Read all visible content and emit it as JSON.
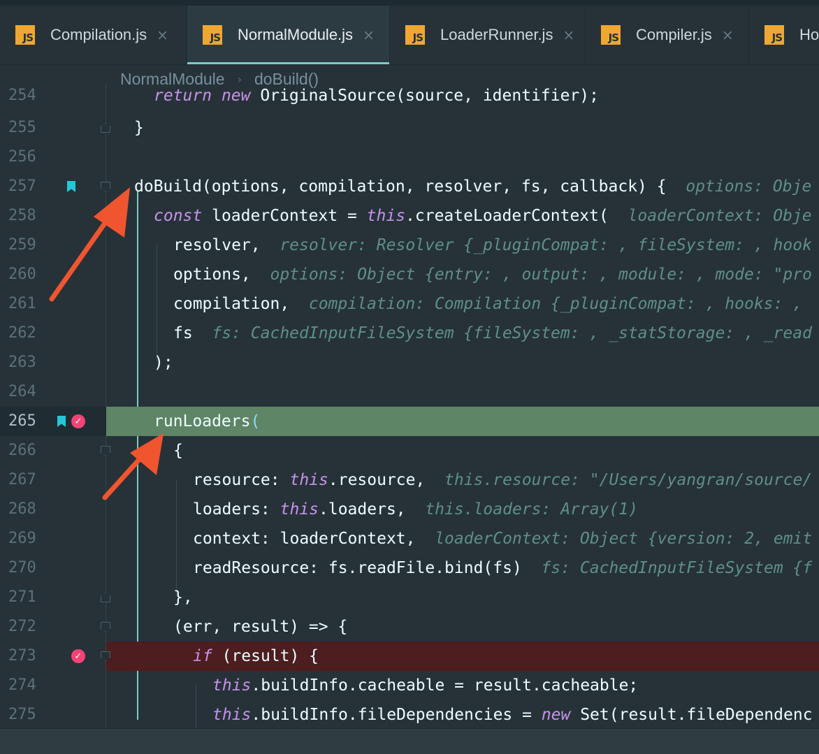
{
  "tabs": [
    {
      "icon": "JS",
      "label": "Compilation.js",
      "close": "×",
      "active": false
    },
    {
      "icon": "JS",
      "label": "NormalModule.js",
      "close": "×",
      "active": true
    },
    {
      "icon": "JS",
      "label": "LoaderRunner.js",
      "close": "×",
      "active": false
    },
    {
      "icon": "JS",
      "label": "Compiler.js",
      "close": "×",
      "active": false
    },
    {
      "icon": "JS",
      "label": "Ho",
      "close": "",
      "active": false
    }
  ],
  "breadcrumb": [
    "NormalModule",
    "doBuild()"
  ],
  "lines": [
    {
      "n": "254",
      "tokens": [
        {
          "t": "return",
          "c": "kw"
        },
        {
          "t": " "
        },
        {
          "t": "new",
          "c": "kw"
        },
        {
          "t": " OriginalSource(source, identifier);"
        }
      ]
    },
    {
      "n": "255",
      "tokens": [
        {
          "t": "}"
        }
      ]
    },
    {
      "n": "256",
      "tokens": []
    },
    {
      "n": "257",
      "tokens": [
        {
          "t": "doBuild(options, compilation, resolver, fs, callback) {"
        },
        {
          "t": "  options: Obje",
          "c": "hint"
        }
      ]
    },
    {
      "n": "258",
      "tokens": [
        {
          "t": "const",
          "c": "kw"
        },
        {
          "t": " loaderContext = "
        },
        {
          "t": "this",
          "c": "kw"
        },
        {
          "t": ".createLoaderContext("
        },
        {
          "t": "  loaderContext: Obje",
          "c": "hint"
        }
      ]
    },
    {
      "n": "259",
      "tokens": [
        {
          "t": "resolver,"
        },
        {
          "t": "  resolver: Resolver {_pluginCompat: , fileSystem: , hook",
          "c": "hint"
        }
      ]
    },
    {
      "n": "260",
      "tokens": [
        {
          "t": "options,"
        },
        {
          "t": "  options: Object {entry: , output: , module: , mode: \"pro",
          "c": "hint"
        }
      ]
    },
    {
      "n": "261",
      "tokens": [
        {
          "t": "compilation,"
        },
        {
          "t": "  compilation: Compilation {_pluginCompat: , hooks: , ",
          "c": "hint"
        }
      ]
    },
    {
      "n": "262",
      "tokens": [
        {
          "t": "fs"
        },
        {
          "t": "  fs: CachedInputFileSystem {fileSystem: , _statStorage: , _read",
          "c": "hint"
        }
      ]
    },
    {
      "n": "263",
      "tokens": [
        {
          "t": ");"
        }
      ]
    },
    {
      "n": "264",
      "tokens": []
    },
    {
      "n": "265",
      "tokens": [
        {
          "t": "runLoaders"
        },
        {
          "t": "(",
          "c": "pn"
        }
      ]
    },
    {
      "n": "266",
      "tokens": [
        {
          "t": "{"
        }
      ]
    },
    {
      "n": "267",
      "tokens": [
        {
          "t": "resource: "
        },
        {
          "t": "this",
          "c": "kw"
        },
        {
          "t": ".resource,"
        },
        {
          "t": "  this.resource: \"/Users/yangran/source/",
          "c": "hint"
        }
      ]
    },
    {
      "n": "268",
      "tokens": [
        {
          "t": "loaders: "
        },
        {
          "t": "this",
          "c": "kw"
        },
        {
          "t": ".loaders,"
        },
        {
          "t": "  this.loaders: Array(1)",
          "c": "hint"
        }
      ]
    },
    {
      "n": "269",
      "tokens": [
        {
          "t": "context: loaderContext,"
        },
        {
          "t": "  loaderContext: Object {version: 2, emit",
          "c": "hint"
        }
      ]
    },
    {
      "n": "270",
      "tokens": [
        {
          "t": "readResource: fs.readFile.bind(fs)"
        },
        {
          "t": "  fs: CachedInputFileSystem {f",
          "c": "hint"
        }
      ]
    },
    {
      "n": "271",
      "tokens": [
        {
          "t": "},"
        }
      ]
    },
    {
      "n": "272",
      "tokens": [
        {
          "t": "(err, result) => {"
        }
      ]
    },
    {
      "n": "273",
      "tokens": [
        {
          "t": "if",
          "c": "kw"
        },
        {
          "t": " (result) {"
        }
      ]
    },
    {
      "n": "274",
      "tokens": [
        {
          "t": "this",
          "c": "kw"
        },
        {
          "t": ".buildInfo.cacheable = result.cacheable;"
        }
      ]
    },
    {
      "n": "275",
      "tokens": [
        {
          "t": "this",
          "c": "kw"
        },
        {
          "t": ".buildInfo.fileDependencies = "
        },
        {
          "t": "new",
          "c": "kw"
        },
        {
          "t": " Set(result.fileDependenc"
        }
      ]
    }
  ],
  "colors": {
    "background": "#263238",
    "accent": "#80cbc4",
    "execution_line": "#5e8565",
    "breakpoint_line": "#4d1d1f",
    "breakpoint": "#f44375",
    "bookmark": "#26c6da",
    "keyword": "#c792ea",
    "inline_hint": "#5f8f86",
    "annotation_arrow": "#f0552f"
  }
}
